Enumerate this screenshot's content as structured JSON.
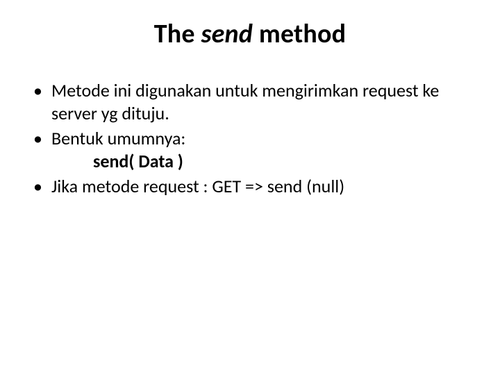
{
  "title": {
    "prefix": "The ",
    "em": "send",
    "suffix": " method"
  },
  "bullets": {
    "b1": "Metode ini digunakan untuk mengirimkan request ke server yg dituju.",
    "b2_line1": "Bentuk umumnya:",
    "b2_indent": "send( Data )",
    "b3": "Jika metode request : GET => send (null)"
  }
}
